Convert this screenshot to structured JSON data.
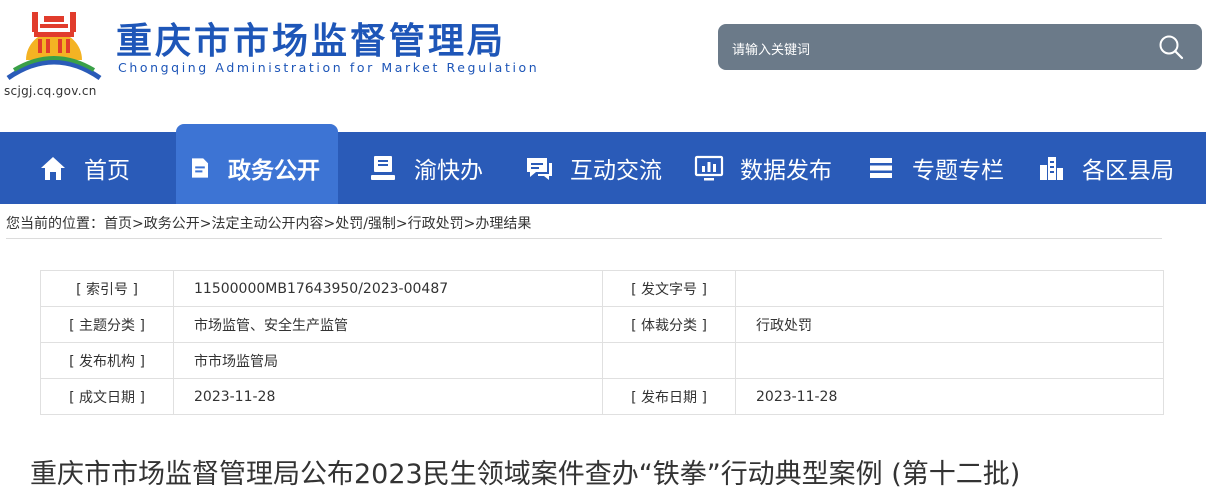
{
  "header": {
    "site_title": "重庆市市场监督管理局",
    "site_subtitle": "Chongqing  Administration for Market Regulation",
    "domain": "scjgj.cq.gov.cn"
  },
  "search": {
    "placeholder": "请输入关键词"
  },
  "nav": {
    "items": [
      {
        "label": "首页"
      },
      {
        "label": "政务公开"
      },
      {
        "label": "渝快办"
      },
      {
        "label": "互动交流"
      },
      {
        "label": "数据发布"
      },
      {
        "label": "专题专栏"
      },
      {
        "label": "各区县局"
      }
    ]
  },
  "breadcrumb": {
    "text": "您当前的位置：首页>政务公开>法定主动公开内容>处罚/强制>行政处罚>办理结果"
  },
  "meta": {
    "index_label": "[ 索引号 ]",
    "index_value": "11500000MB17643950/2023-00487",
    "doc_no_label": "[ 发文字号 ]",
    "doc_no_value": "",
    "subject_label": "[ 主题分类 ]",
    "subject_value": "市场监管、安全生产监管",
    "genre_label": "[ 体裁分类 ]",
    "genre_value": "行政处罚",
    "issuer_label": "[ 发布机构 ]",
    "issuer_value": "市市场监管局",
    "created_label": "[ 成文日期 ]",
    "created_value": "2023-11-28",
    "published_label": "[ 发布日期 ]",
    "published_value": "2023-11-28"
  },
  "article": {
    "title": "重庆市市场监督管理局公布2023民生领域案件查办“铁拳”行动典型案例 (第十二批)"
  },
  "colors": {
    "brand": "#1e56b8",
    "nav": "#2a5bb8",
    "nav_active": "#3d74d4",
    "search_bg": "#6b7a89"
  }
}
